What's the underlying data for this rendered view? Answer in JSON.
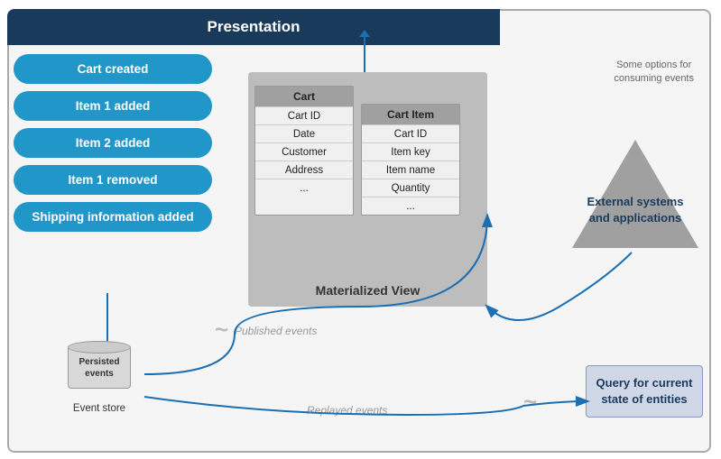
{
  "presentation": {
    "title": "Presentation"
  },
  "events": [
    {
      "label": "Cart created"
    },
    {
      "label": "Item 1 added"
    },
    {
      "label": "Item 2 added"
    },
    {
      "label": "Item 1 removed"
    },
    {
      "label": "Shipping information added"
    }
  ],
  "event_store": {
    "cylinder_text": "Persisted events",
    "label": "Event store"
  },
  "cart_table": {
    "header": "Cart",
    "rows": [
      "Cart ID",
      "Date",
      "Customer",
      "Address",
      "..."
    ]
  },
  "cart_item_table": {
    "header": "Cart Item",
    "rows": [
      "Cart ID",
      "Item key",
      "Item name",
      "Quantity",
      "..."
    ]
  },
  "materialized_view": {
    "label": "Materialized View"
  },
  "triangle": {
    "text": "External systems and applications"
  },
  "some_options": {
    "text": "Some options for\nconsuming events"
  },
  "published_events": {
    "label": "Published events"
  },
  "replayed_events": {
    "label": "Replayed events"
  },
  "query_box": {
    "text": "Query for current state of entities"
  }
}
